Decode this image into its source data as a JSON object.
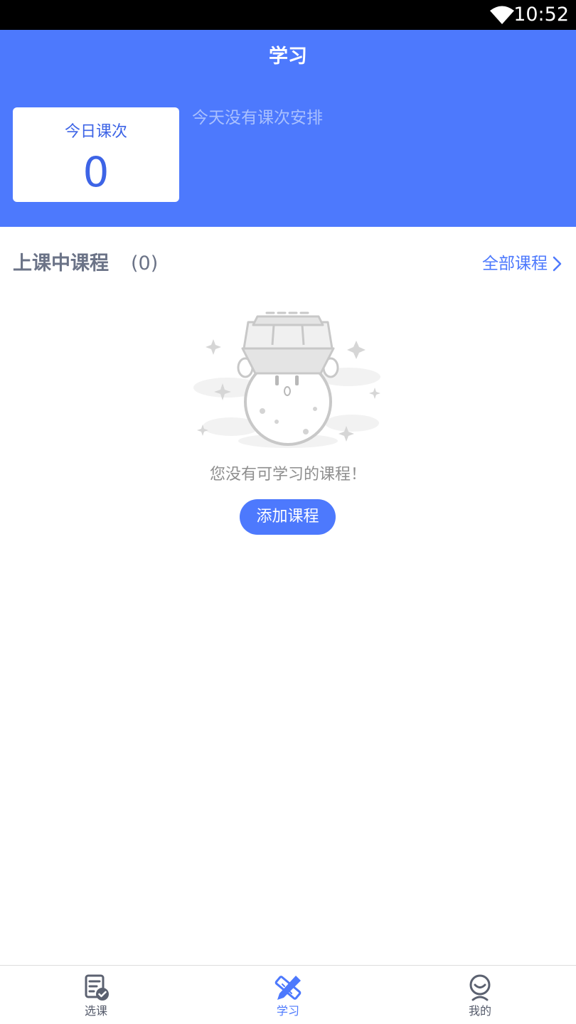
{
  "status_bar": {
    "time": "10:52",
    "wifi_icon": "wifi-icon"
  },
  "header": {
    "title": "学习"
  },
  "today_card": {
    "label": "今日课次",
    "count": "0"
  },
  "schedule_message": "今天没有课次安排",
  "section": {
    "title": "上课中课程",
    "count": "(0)",
    "all_courses_label": "全部课程",
    "chevron_icon": "chevron-right-icon"
  },
  "empty_state": {
    "illustration": "empty-moon-illustration",
    "message": "您没有可学习的课程！",
    "button_label": "添加课程"
  },
  "tabs": [
    {
      "label": "选课",
      "icon": "course-list-icon",
      "active": false
    },
    {
      "label": "学习",
      "icon": "pencil-ruler-icon",
      "active": true
    },
    {
      "label": "我的",
      "icon": "profile-icon",
      "active": false
    }
  ],
  "colors": {
    "primary": "#4d79fd",
    "card_text": "#3d64e6",
    "muted_text": "#8e8e8e",
    "section_text": "#6b7387"
  }
}
